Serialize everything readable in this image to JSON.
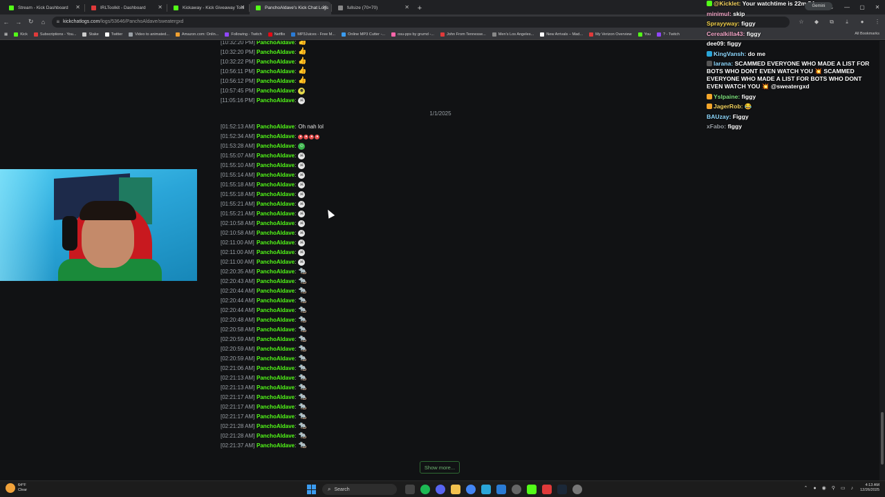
{
  "browser": {
    "tabs": [
      {
        "title": "Stream - Kick Dashboard",
        "color": "#53fc18",
        "active": false
      },
      {
        "title": "IRLToolkit - Dashboard",
        "color": "#e03a3a",
        "active": false
      },
      {
        "title": "Kickaway - Kick Giveaway Tool",
        "color": "#53fc18",
        "active": false
      },
      {
        "title": "PanchoAldave's Kick Chat Logs",
        "color": "#53fc18",
        "active": true
      },
      {
        "title": "fullsize (70×70)",
        "color": "#888888",
        "active": false
      }
    ],
    "url_host": "kickchatlogs.com",
    "url_path": "/logs/53646/PanchoAldave/sweatergxd",
    "bookmarks": [
      {
        "label": "Kick",
        "color": "#53fc18"
      },
      {
        "label": "Subscriptions - You...",
        "color": "#e03a3a"
      },
      {
        "label": "Stake",
        "color": "#cccccc"
      },
      {
        "label": "Twitter",
        "color": "#ffffff"
      },
      {
        "label": "Video to animated...",
        "color": "#9aa0a6"
      },
      {
        "label": "Amazon.com: Onlin...",
        "color": "#f0a030"
      },
      {
        "label": "Following - Twitch",
        "color": "#9147ff"
      },
      {
        "label": "Netflix",
        "color": "#e50914"
      },
      {
        "label": "MP3Juices - Free M...",
        "color": "#2a7bd5"
      },
      {
        "label": "Online MP3 Cutter -...",
        "color": "#3b9cf0"
      },
      {
        "label": "osu-pps by grumd -...",
        "color": "#ff66aa"
      },
      {
        "label": "John From Tennesse...",
        "color": "#e03a3a"
      },
      {
        "label": "Men's Los Angeles...",
        "color": "#888888"
      },
      {
        "label": "New Arrivals – Mad...",
        "color": "#ffffff"
      },
      {
        "label": "My Verizon Overview",
        "color": "#e03a3a"
      },
      {
        "label": "You",
        "color": "#53fc18"
      },
      {
        "label": "? - Twitch",
        "color": "#9147ff"
      }
    ],
    "all_bookmarks": "All Bookmarks",
    "gemini": "Gemini"
  },
  "chat_logs": {
    "date_separator": "1/1/2025",
    "show_more": "Show more...",
    "entries_before": [
      {
        "ts": "[10:32:20 PM]",
        "user": "PanchoAldave",
        "emote": "thumbs"
      },
      {
        "ts": "[10:32:20 PM]",
        "user": "PanchoAldave",
        "emote": "thumbs"
      },
      {
        "ts": "[10:32:22 PM]",
        "user": "PanchoAldave",
        "emote": "thumbs"
      },
      {
        "ts": "[10:56:11 PM]",
        "user": "PanchoAldave",
        "emote": "thumbs"
      },
      {
        "ts": "[10:56:12 PM]",
        "user": "PanchoAldave",
        "emote": "thumbs"
      },
      {
        "ts": "[10:57:45 PM]",
        "user": "PanchoAldave",
        "emote": "toxic"
      },
      {
        "ts": "[11:05:16 PM]",
        "user": "PanchoAldave",
        "emote": "skull"
      }
    ],
    "entries_after": [
      {
        "ts": "[01:52:13 AM]",
        "user": "PanchoAldave",
        "text": "Oh nah lol"
      },
      {
        "ts": "[01:52:34 AM]",
        "user": "PanchoAldave",
        "emote": "rage4"
      },
      {
        "ts": "[01:53:28 AM]",
        "user": "PanchoAldave",
        "emote": "smile"
      },
      {
        "ts": "[01:55:07 AM]",
        "user": "PanchoAldave",
        "emote": "skull"
      },
      {
        "ts": "[01:55:10 AM]",
        "user": "PanchoAldave",
        "emote": "skull"
      },
      {
        "ts": "[01:55:14 AM]",
        "user": "PanchoAldave",
        "emote": "skull"
      },
      {
        "ts": "[01:55:18 AM]",
        "user": "PanchoAldave",
        "emote": "skull"
      },
      {
        "ts": "[01:55:18 AM]",
        "user": "PanchoAldave",
        "emote": "skull"
      },
      {
        "ts": "[01:55:21 AM]",
        "user": "PanchoAldave",
        "emote": "skull"
      },
      {
        "ts": "[01:55:21 AM]",
        "user": "PanchoAldave",
        "emote": "skull"
      },
      {
        "ts": "[02:10:58 AM]",
        "user": "PanchoAldave",
        "emote": "skull"
      },
      {
        "ts": "[02:10:58 AM]",
        "user": "PanchoAldave",
        "emote": "skull"
      },
      {
        "ts": "[02:11:00 AM]",
        "user": "PanchoAldave",
        "emote": "skull"
      },
      {
        "ts": "[02:11:00 AM]",
        "user": "PanchoAldave",
        "emote": "skull"
      },
      {
        "ts": "[02:11:00 AM]",
        "user": "PanchoAldave",
        "emote": "skull"
      },
      {
        "ts": "[02:20:35 AM]",
        "user": "PanchoAldave",
        "emote": "rat"
      },
      {
        "ts": "[02:20:43 AM]",
        "user": "PanchoAldave",
        "emote": "rat"
      },
      {
        "ts": "[02:20:44 AM]",
        "user": "PanchoAldave",
        "emote": "rat"
      },
      {
        "ts": "[02:20:44 AM]",
        "user": "PanchoAldave",
        "emote": "rat"
      },
      {
        "ts": "[02:20:44 AM]",
        "user": "PanchoAldave",
        "emote": "rat"
      },
      {
        "ts": "[02:20:48 AM]",
        "user": "PanchoAldave",
        "emote": "rat"
      },
      {
        "ts": "[02:20:58 AM]",
        "user": "PanchoAldave",
        "emote": "rat"
      },
      {
        "ts": "[02:20:59 AM]",
        "user": "PanchoAldave",
        "emote": "rat"
      },
      {
        "ts": "[02:20:59 AM]",
        "user": "PanchoAldave",
        "emote": "rat"
      },
      {
        "ts": "[02:20:59 AM]",
        "user": "PanchoAldave",
        "emote": "rat"
      },
      {
        "ts": "[02:21:06 AM]",
        "user": "PanchoAldave",
        "emote": "rat"
      },
      {
        "ts": "[02:21:13 AM]",
        "user": "PanchoAldave",
        "emote": "rat"
      },
      {
        "ts": "[02:21:13 AM]",
        "user": "PanchoAldave",
        "emote": "rat"
      },
      {
        "ts": "[02:21:17 AM]",
        "user": "PanchoAldave",
        "emote": "rat"
      },
      {
        "ts": "[02:21:17 AM]",
        "user": "PanchoAldave",
        "emote": "rat"
      },
      {
        "ts": "[02:21:17 AM]",
        "user": "PanchoAldave",
        "emote": "rat"
      },
      {
        "ts": "[02:21:28 AM]",
        "user": "PanchoAldave",
        "emote": "rat"
      },
      {
        "ts": "[02:21:28 AM]",
        "user": "PanchoAldave",
        "emote": "rat"
      },
      {
        "ts": "[02:21:37 AM]",
        "user": "PanchoAldave",
        "emote": "rat"
      }
    ]
  },
  "overlay_chat": [
    {
      "user": "@Kicklet:",
      "text": "Your watchtime is 22m 54s.",
      "color": "#f4d35e",
      "badge": "#53fc18"
    },
    {
      "user": "minimul:",
      "text": "skip",
      "color": "#f4a6c8",
      "badge": ""
    },
    {
      "user": "Sprayyway:",
      "text": "figgy",
      "color": "#f2d04a",
      "badge": ""
    },
    {
      "user": "Cerealkilla43:",
      "text": "figgy",
      "color": "#f4a6c8",
      "badge": ""
    },
    {
      "user": "dee09:",
      "text": "figgy",
      "color": "#ffffff",
      "badge": ""
    },
    {
      "user": "KingVansh:",
      "text": "do me",
      "color": "#8fd9ff",
      "badge": "#2aa5d8"
    },
    {
      "user": "larana:",
      "text": "SCAMMED EVERYONE WHO MADE A LIST FOR BOTS WHO DONT EVEN WATCH YOU 💥 SCAMMED EVERYONE WHO MADE A LIST FOR BOTS WHO DONT EVEN WATCH YOU 💥 @sweatergxd",
      "color": "#8fd9ff",
      "badge": "#555"
    },
    {
      "user": "Yslpaine:",
      "text": "figgy",
      "color": "#7de07d",
      "badge": "#f4a62a"
    },
    {
      "user": "JagerRob:",
      "text": "😂",
      "color": "#f4d35e",
      "badge": "#f4a62a"
    },
    {
      "user": "BAUzay:",
      "text": "Figgy",
      "color": "#8fd9ff",
      "badge": ""
    },
    {
      "user": "xFabo:",
      "text": "figgy",
      "color": "#9aa0a6",
      "badge": ""
    }
  ],
  "taskbar": {
    "weather_temp": "64°F",
    "weather_desc": "Clear",
    "search_label": "Search",
    "time": "4:13 AM",
    "date": "12/26/2025"
  }
}
